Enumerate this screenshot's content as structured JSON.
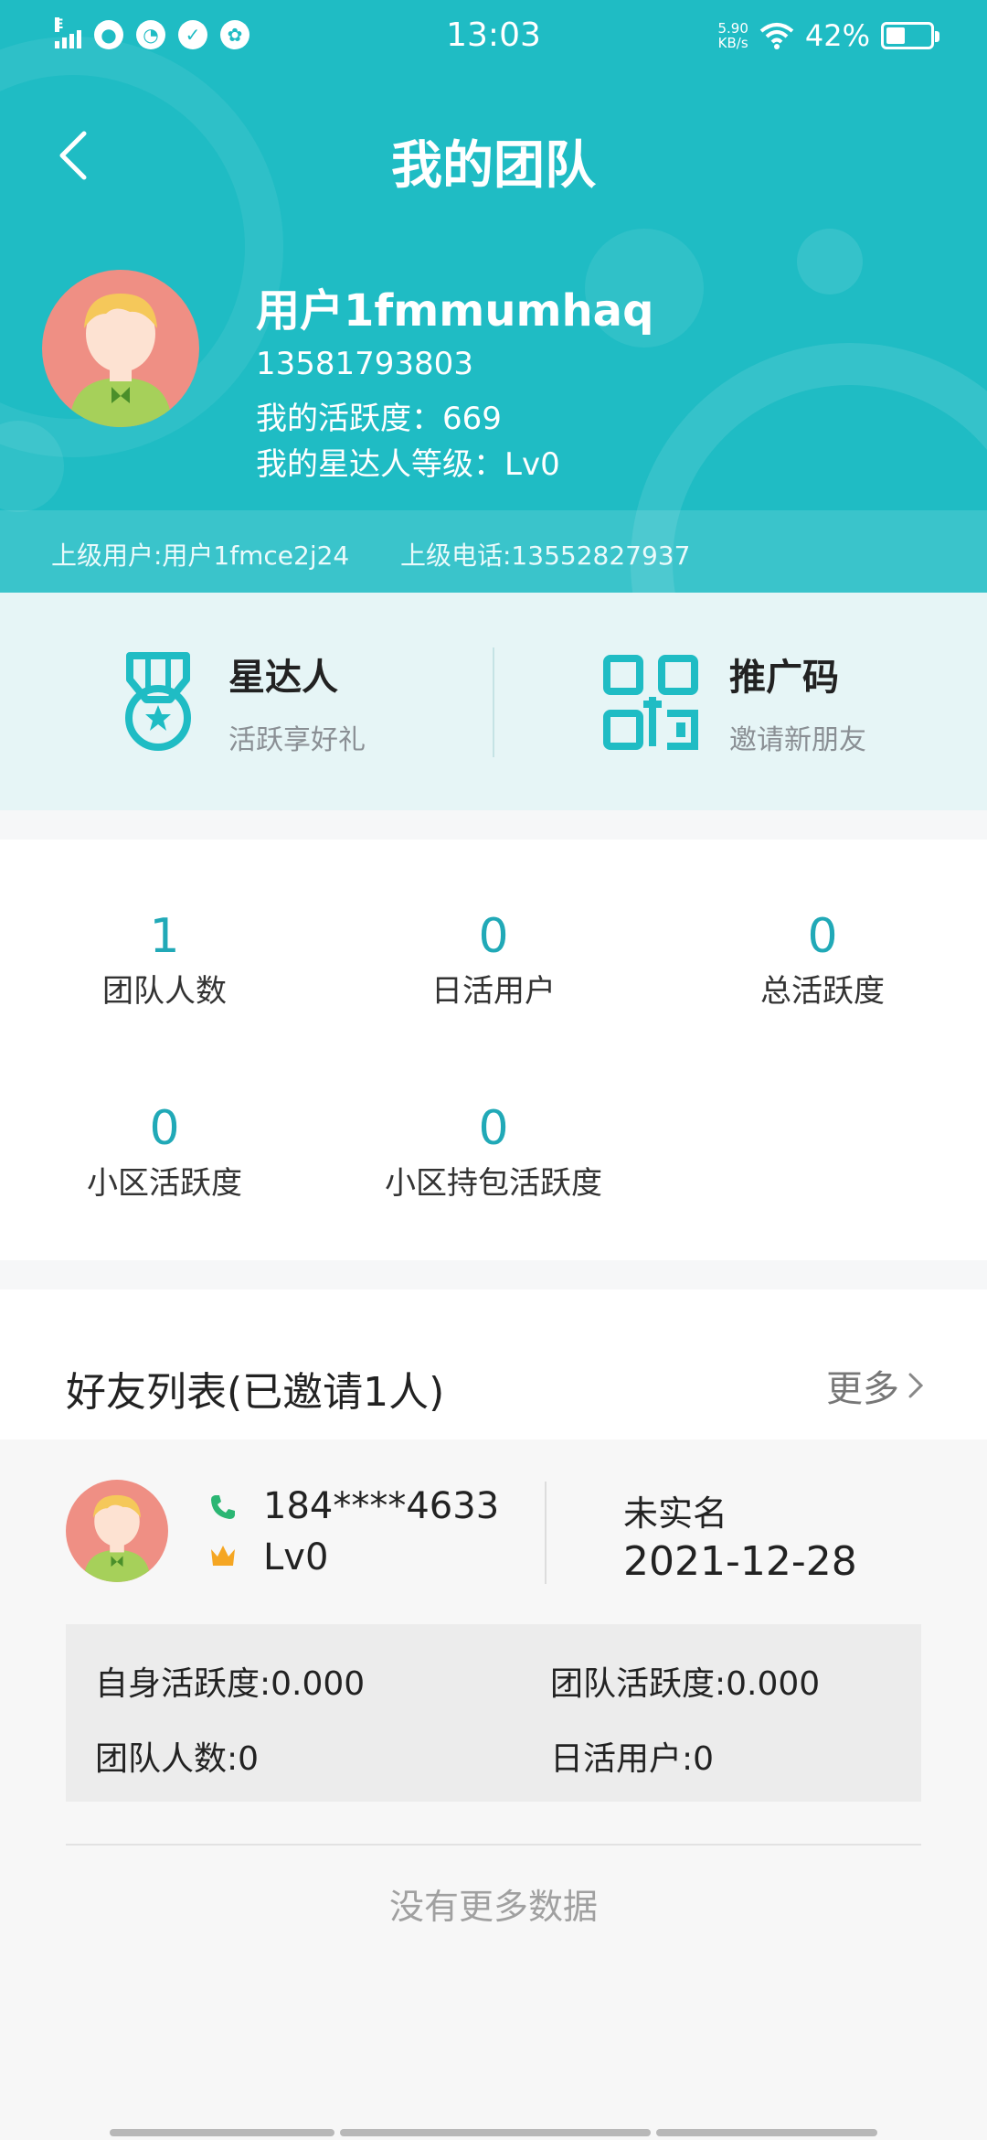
{
  "status_bar": {
    "time": "13:03",
    "net_speed_value": "5.90",
    "net_speed_unit": "KB/s",
    "battery": "42%",
    "signal_label": "E",
    "icons": [
      "signal-icon",
      "wechat-icon",
      "notification-icon",
      "check-icon",
      "fan-icon",
      "wifi-icon",
      "battery-icon"
    ]
  },
  "header": {
    "title": "我的团队"
  },
  "profile": {
    "name": "用户1fmmumhaq",
    "phone": "13581793803",
    "activity": "我的活跃度：669",
    "star_level": "我的星达人等级：Lv0",
    "superior_user": "上级用户:用户1fmce2j24",
    "superior_phone": "上级电话:13552827937"
  },
  "features": [
    {
      "title": "星达人",
      "subtitle": "活跃享好礼",
      "icon": "medal-icon"
    },
    {
      "title": "推广码",
      "subtitle": "邀请新朋友",
      "icon": "qr-code-icon"
    }
  ],
  "stats": [
    {
      "value": "1",
      "label": "团队人数"
    },
    {
      "value": "0",
      "label": "日活用户"
    },
    {
      "value": "0",
      "label": "总活跃度"
    },
    {
      "value": "0",
      "label": "小区活跃度"
    },
    {
      "value": "0",
      "label": "小区持包活跃度"
    }
  ],
  "friends": {
    "title": "好友列表(已邀请1人)",
    "more": "更多",
    "items": [
      {
        "phone": "184****4633",
        "level": "Lv0",
        "realname_status": "未实名",
        "date": "2021-12-28",
        "self_activity": "自身活跃度:0.000",
        "team_activity": "团队活跃度:0.000",
        "team_count": "团队人数:0",
        "daily_users": "日活用户:0"
      }
    ],
    "no_more": "没有更多数据"
  },
  "colors": {
    "accent": "#1fbcc4",
    "stat_value": "#21a9b7",
    "avatar_bg": "#ef8f84"
  }
}
